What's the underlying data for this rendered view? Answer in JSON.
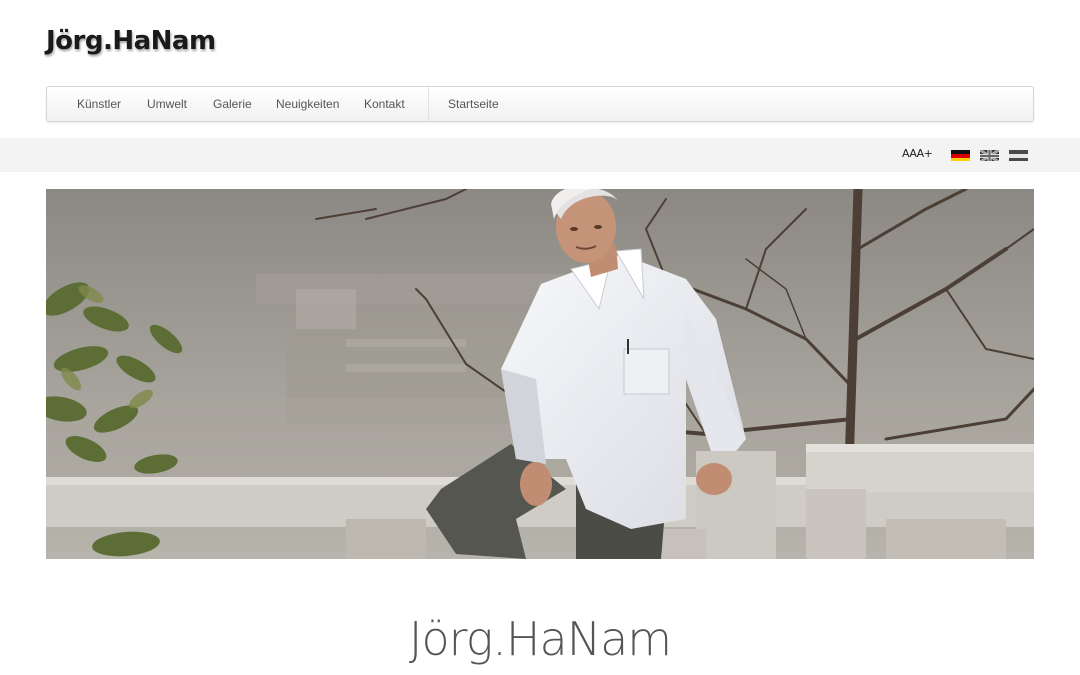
{
  "site": {
    "title": "Jörg.HaNam"
  },
  "nav": {
    "items": [
      {
        "label": "Künstler"
      },
      {
        "label": "Umwelt"
      },
      {
        "label": "Galerie"
      },
      {
        "label": "Neuigkeiten"
      },
      {
        "label": "Kontakt"
      },
      {
        "label": "Startseite"
      }
    ]
  },
  "toolbar": {
    "font_size_label": "AAA+",
    "languages": [
      {
        "icon": "flag-germany-icon"
      },
      {
        "icon": "flag-uk-icon"
      },
      {
        "icon": "flag-netherlands-icon"
      }
    ]
  },
  "main": {
    "heading": "Jörg.HaNam"
  }
}
